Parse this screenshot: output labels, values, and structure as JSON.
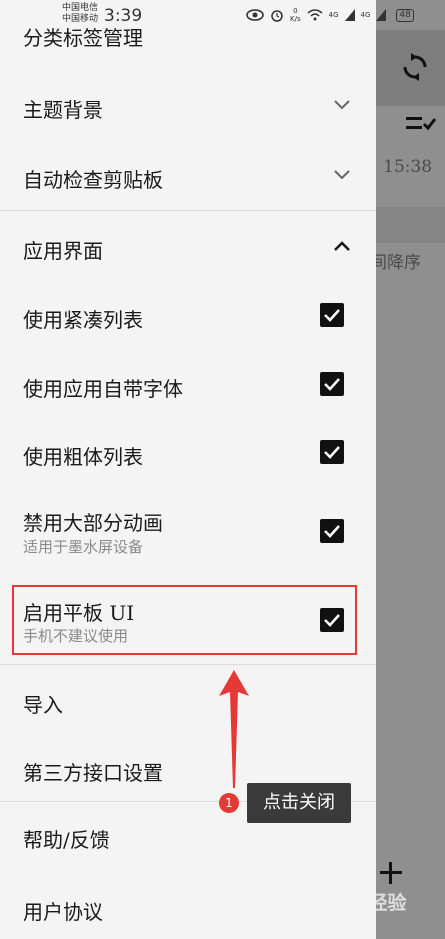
{
  "status_bar": {
    "carrier_1": "中国电信",
    "carrier_2": "中国移动",
    "time": "3:39",
    "net_speed_value": "0",
    "net_speed_unit": "K/s",
    "signal_1": "4G",
    "signal_2": "4G",
    "battery": "48"
  },
  "drawer": {
    "items": [
      {
        "label": "分类标签管理"
      },
      {
        "label": "主题背景",
        "expanded": false
      },
      {
        "label": "自动检查剪贴板",
        "expanded": false
      },
      {
        "label": "应用界面",
        "expanded": true
      },
      {
        "label": "使用紧凑列表",
        "checked": true
      },
      {
        "label": "使用应用自带字体",
        "checked": true
      },
      {
        "label": "使用粗体列表",
        "checked": true
      },
      {
        "label": "禁用大部分动画",
        "sublabel": "适用于墨水屏设备",
        "checked": true
      },
      {
        "label": "启用平板 UI",
        "sublabel": "手机不建议使用",
        "checked": true
      },
      {
        "label": "导入"
      },
      {
        "label": "第三方接口设置"
      },
      {
        "label": "帮助/反馈"
      },
      {
        "label": "用户协议"
      }
    ]
  },
  "background": {
    "time_fragment": "| 15:38",
    "sort_fragment": "间降序",
    "add_symbol": "+"
  },
  "annotation": {
    "badge": "1",
    "tip": "点击关闭",
    "highlight_color": "#e53935"
  },
  "watermark": "Bai 经验"
}
